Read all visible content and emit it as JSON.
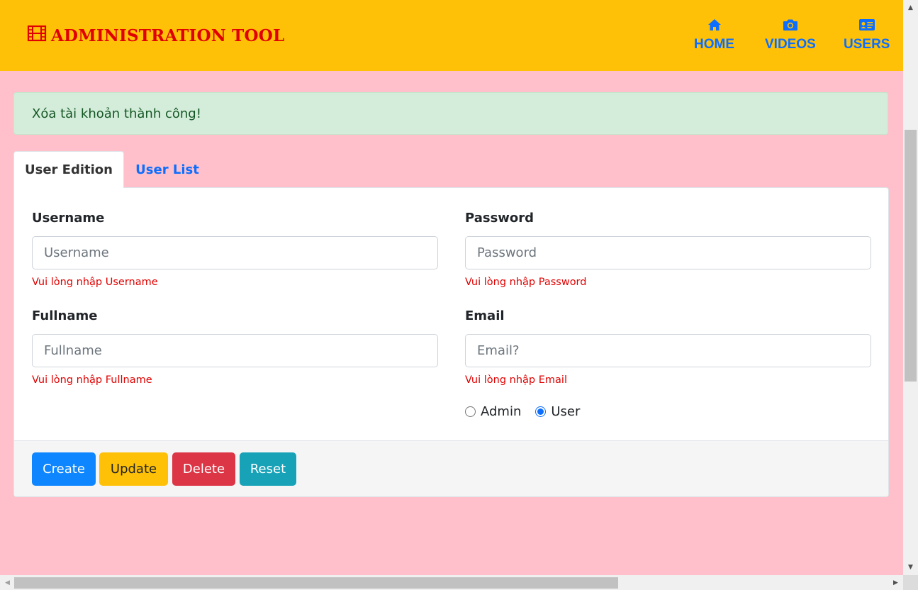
{
  "header": {
    "brand": "ADMINISTRATION TOOL",
    "brand_icon": "film-icon",
    "nav": [
      {
        "label": "HOME",
        "icon": "home-icon"
      },
      {
        "label": "VIDEOS",
        "icon": "camera-icon"
      },
      {
        "label": "USERS",
        "icon": "id-card-icon"
      }
    ]
  },
  "alert": {
    "message": "Xóa tài khoản thành công!"
  },
  "tabs": [
    {
      "label": "User Edition",
      "active": true
    },
    {
      "label": "User List",
      "active": false
    }
  ],
  "form": {
    "username": {
      "label": "Username",
      "value": "",
      "placeholder": "Username",
      "error": "Vui lòng nhập Username"
    },
    "password": {
      "label": "Password",
      "value": "",
      "placeholder": "Password",
      "error": "Vui lòng nhập Password"
    },
    "fullname": {
      "label": "Fullname",
      "value": "",
      "placeholder": "Fullname",
      "error": "Vui lòng nhập Fullname"
    },
    "email": {
      "label": "Email",
      "value": "",
      "placeholder": "Email?",
      "error": "Vui lòng nhập Email"
    },
    "roles": [
      {
        "label": "Admin",
        "checked": false
      },
      {
        "label": "User",
        "checked": true
      }
    ]
  },
  "buttons": {
    "create": "Create",
    "update": "Update",
    "delete": "Delete",
    "reset": "Reset"
  },
  "colors": {
    "header_bg": "#ffc107",
    "page_bg": "#ffc0cb",
    "brand": "#e00000",
    "nav_link": "#0d6efd",
    "alert_bg": "#d4edda",
    "error_text": "#e00000"
  }
}
